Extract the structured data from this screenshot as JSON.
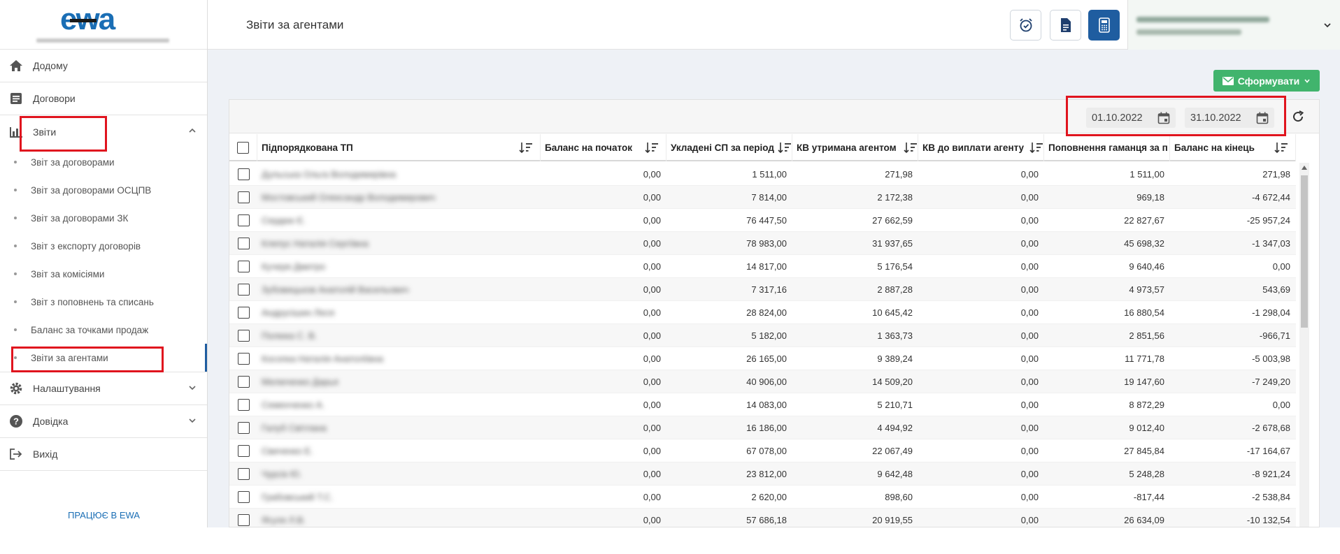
{
  "logo": {
    "text": "ewa"
  },
  "sidebar": {
    "items": [
      {
        "label": "Додому",
        "icon": "home-icon"
      },
      {
        "label": "Договори",
        "icon": "contract-icon"
      },
      {
        "label": "Звіти",
        "icon": "bar-chart-icon",
        "expanded": true
      }
    ],
    "reports_sub": [
      "Звіт за договорами",
      "Звіт за договорами ОСЦПВ",
      "Звіт за договорами ЗК",
      "Звіт з експорту договорів",
      "Звіт за комісіями",
      "Звіт з поповнень та списань",
      "Баланс за точками продаж",
      "Звіти за агентами"
    ],
    "bottom_items": [
      {
        "label": "Налаштування",
        "icon": "gear-icon"
      },
      {
        "label": "Довідка",
        "icon": "help-icon"
      },
      {
        "label": "Вихід",
        "icon": "logout-icon"
      }
    ],
    "footer_link": "ПРАЦЮЄ В EWA"
  },
  "header": {
    "title": "Звіти за агентами"
  },
  "toolbar": {
    "generate_label": "Сформувати",
    "date_from": "01.10.2022",
    "date_to": "31.10.2022"
  },
  "table": {
    "columns": [
      "Підпорядкована ТП",
      "Баланс на початок",
      "Укладені СП за період",
      "КВ утримана агентом",
      "КВ до виплати агенту",
      "Поповнення гаманця за п",
      "Баланс на кінець"
    ],
    "rows": [
      [
        "Дульська Ольга Володимирівна",
        "0,00",
        "1 511,00",
        "271,98",
        "0,00",
        "1 511,00",
        "271,98"
      ],
      [
        "Мостовський Олександр Володимирович",
        "0,00",
        "7 814,00",
        "2 172,38",
        "0,00",
        "969,18",
        "-4 672,44"
      ],
      [
        "Сердюк Є.",
        "0,00",
        "76 447,50",
        "27 662,59",
        "0,00",
        "22 827,67",
        "-25 957,24"
      ],
      [
        "Клепус Наталія Сергіївна",
        "0,00",
        "78 983,00",
        "31 937,65",
        "0,00",
        "45 698,32",
        "-1 347,03"
      ],
      [
        "Кучеря Дмитро",
        "0,00",
        "14 817,00",
        "5 176,54",
        "0,00",
        "9 640,46",
        "0,00"
      ],
      [
        "Зубовицьков Анатолій Васильович",
        "0,00",
        "7 317,16",
        "2 887,28",
        "0,00",
        "4 973,57",
        "543,69"
      ],
      [
        "Андрусішин Леся",
        "0,00",
        "28 824,00",
        "10 645,42",
        "0,00",
        "16 880,54",
        "-1 298,04"
      ],
      [
        "Полюка С. В.",
        "0,00",
        "5 182,00",
        "1 363,73",
        "0,00",
        "2 851,56",
        "-966,71"
      ],
      [
        "Косопка Наталія Анатоліївна",
        "0,00",
        "26 165,00",
        "9 389,24",
        "0,00",
        "11 771,78",
        "-5 003,98"
      ],
      [
        "Мелюченко Дарья",
        "0,00",
        "40 906,00",
        "14 509,20",
        "0,00",
        "19 147,60",
        "-7 249,20"
      ],
      [
        "Семенченко А.",
        "0,00",
        "14 083,00",
        "5 210,71",
        "0,00",
        "8 872,29",
        "0,00"
      ],
      [
        "Галуб Світлана",
        "0,00",
        "16 186,00",
        "4 494,92",
        "0,00",
        "9 012,40",
        "-2 678,68"
      ],
      [
        "Свиченко Е.",
        "0,00",
        "67 078,00",
        "22 067,49",
        "0,00",
        "27 845,84",
        "-17 164,67"
      ],
      [
        "Чурсік Ю.",
        "0,00",
        "23 812,00",
        "9 642,48",
        "0,00",
        "5 248,28",
        "-8 921,24"
      ],
      [
        "Грабовський Т.С.",
        "0,00",
        "2 620,00",
        "898,60",
        "0,00",
        "-817,44",
        "-2 538,84"
      ],
      [
        "Ягуля Л.В.",
        "0,00",
        "57 686,18",
        "20 919,55",
        "0,00",
        "26 634,09",
        "-10 132,54"
      ]
    ]
  },
  "colors": {
    "accent": "#1f5da0",
    "generate_button": "#41b46d",
    "highlight_box": "#e0141e"
  }
}
